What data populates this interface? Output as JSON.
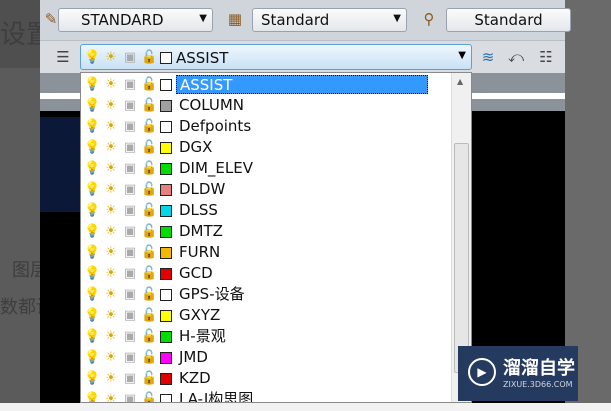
{
  "background_text": [
    "设置",
    "图层",
    "数都设"
  ],
  "toolbar": {
    "text_style": "STANDARD",
    "dim_style": "Standard",
    "table_style": "Standard"
  },
  "layer_combo": {
    "current": "ASSIST"
  },
  "layers": [
    {
      "name": "ASSIST",
      "color": "#ffffff",
      "on": true,
      "selected": true
    },
    {
      "name": "COLUMN",
      "color": "#a0a0a0",
      "on": true
    },
    {
      "name": "Defpoints",
      "color": "#ffffff",
      "on": true
    },
    {
      "name": "DGX",
      "color": "#ffff00",
      "on": true
    },
    {
      "name": "DIM_ELEV",
      "color": "#00dd00",
      "on": true
    },
    {
      "name": "DLDW",
      "color": "#e88080",
      "on": true
    },
    {
      "name": "DLSS",
      "color": "#00d8e8",
      "on": true
    },
    {
      "name": "DMTZ",
      "color": "#00dd00",
      "on": true
    },
    {
      "name": "FURN",
      "color": "#f5b800",
      "on": true
    },
    {
      "name": "GCD",
      "color": "#e00000",
      "on": true
    },
    {
      "name": "GPS-设备",
      "color": "#ffffff",
      "on": true
    },
    {
      "name": "GXYZ",
      "color": "#ffff00",
      "on": true
    },
    {
      "name": "H-景观",
      "color": "#00dd00",
      "on": true
    },
    {
      "name": "JMD",
      "color": "#ff00ff",
      "on": true
    },
    {
      "name": "KZD",
      "color": "#e00000",
      "on": false
    },
    {
      "name": "LA-J构思图",
      "color": "#ffffff",
      "on": false
    }
  ],
  "watermark": {
    "title": "溜溜自学",
    "url": "ZIXUE.3D66.COM"
  }
}
